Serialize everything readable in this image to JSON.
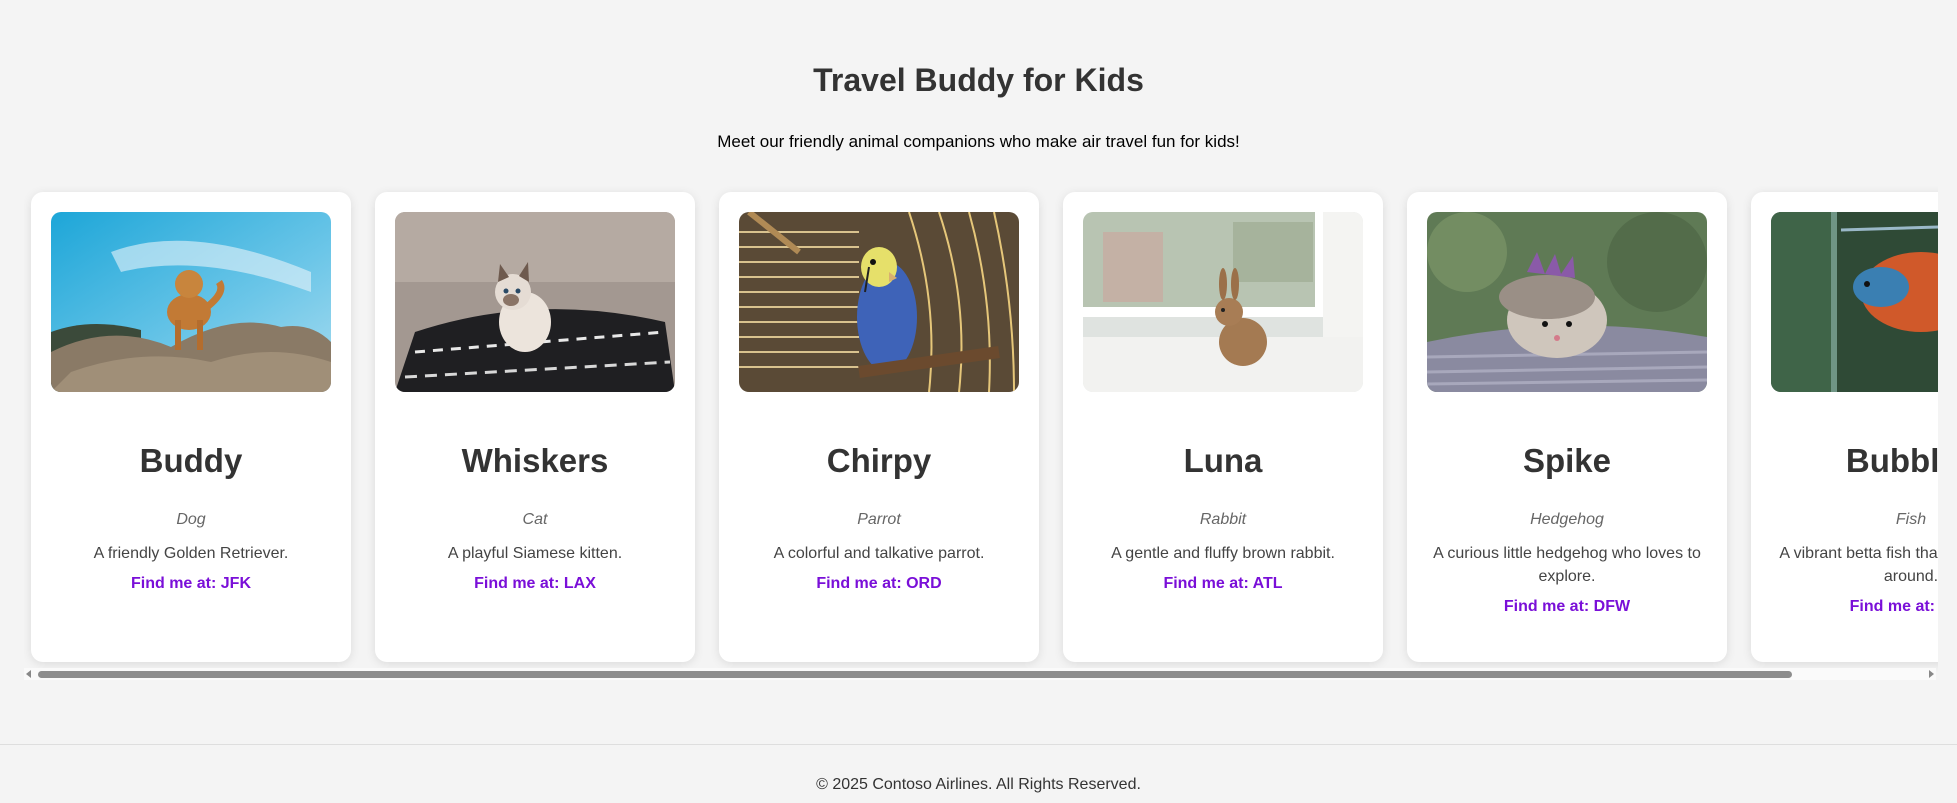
{
  "header": {
    "title": "Travel Buddy for Kids",
    "subtitle": "Meet our friendly animal companions who make air travel fun for kids!"
  },
  "cards": [
    {
      "name": "Buddy",
      "species": "Dog",
      "description": "A friendly Golden Retriever.",
      "location": "Find me at: JFK",
      "image_icon": "golden-retriever-photo"
    },
    {
      "name": "Whiskers",
      "species": "Cat",
      "description": "A playful Siamese kitten.",
      "location": "Find me at: LAX",
      "image_icon": "siamese-kitten-photo"
    },
    {
      "name": "Chirpy",
      "species": "Parrot",
      "description": "A colorful and talkative parrot.",
      "location": "Find me at: ORD",
      "image_icon": "budgie-photo"
    },
    {
      "name": "Luna",
      "species": "Rabbit",
      "description": "A gentle and fluffy brown rabbit.",
      "location": "Find me at: ATL",
      "image_icon": "brown-rabbit-photo"
    },
    {
      "name": "Spike",
      "species": "Hedgehog",
      "description": "A curious little hedgehog who loves to explore.",
      "location": "Find me at: DFW",
      "image_icon": "hedgehog-photo"
    },
    {
      "name": "Bubbles",
      "species": "Fish",
      "description": "A vibrant betta fish that loves to swim around.",
      "location": "Find me at: SEA",
      "image_icon": "betta-fish-photo"
    }
  ],
  "footer": {
    "copyright": "© 2025 Contoso Airlines. All Rights Reserved."
  },
  "colors": {
    "background": "#f4f4f4",
    "accent": "#7a0fd8",
    "card": "#ffffff"
  }
}
